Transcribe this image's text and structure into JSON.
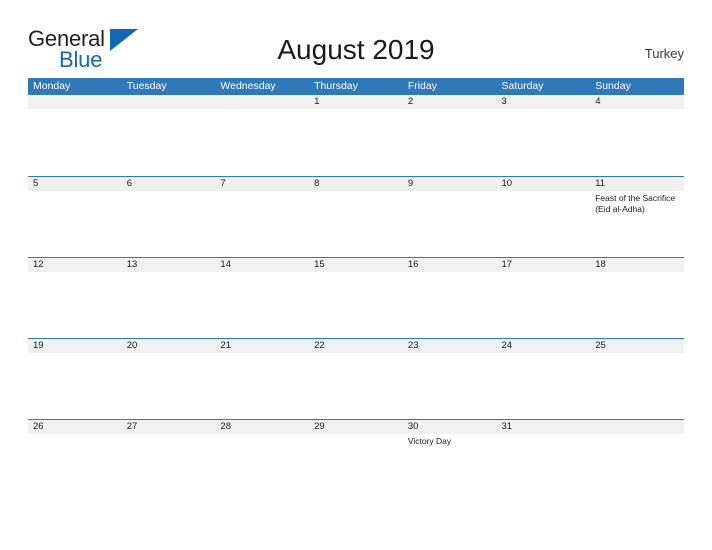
{
  "brand": {
    "name_part1": "General",
    "name_part2": "Blue",
    "triangle_color": "#1268b3",
    "text_color": "#231f20"
  },
  "header": {
    "title": "August 2019",
    "region": "Turkey"
  },
  "theme": {
    "header_blue": "#3178b8",
    "date_band_gray": "#f0f0f0",
    "page_background": "#ffffff",
    "text_color": "#1a1a1a"
  },
  "calendar": {
    "month": "August",
    "year": "2019",
    "weekday_headers": [
      "Monday",
      "Tuesday",
      "Wednesday",
      "Thursday",
      "Friday",
      "Saturday",
      "Sunday"
    ],
    "weeks": [
      {
        "days": [
          {
            "number": "",
            "events": []
          },
          {
            "number": "",
            "events": []
          },
          {
            "number": "",
            "events": []
          },
          {
            "number": "1",
            "events": []
          },
          {
            "number": "2",
            "events": []
          },
          {
            "number": "3",
            "events": []
          },
          {
            "number": "4",
            "events": []
          }
        ]
      },
      {
        "days": [
          {
            "number": "5",
            "events": []
          },
          {
            "number": "6",
            "events": []
          },
          {
            "number": "7",
            "events": []
          },
          {
            "number": "8",
            "events": []
          },
          {
            "number": "9",
            "events": []
          },
          {
            "number": "10",
            "events": []
          },
          {
            "number": "11",
            "events": [
              "Feast of the Sacrifice (Eid al-Adha)"
            ]
          }
        ]
      },
      {
        "days": [
          {
            "number": "12",
            "events": []
          },
          {
            "number": "13",
            "events": []
          },
          {
            "number": "14",
            "events": []
          },
          {
            "number": "15",
            "events": []
          },
          {
            "number": "16",
            "events": []
          },
          {
            "number": "17",
            "events": []
          },
          {
            "number": "18",
            "events": []
          }
        ]
      },
      {
        "days": [
          {
            "number": "19",
            "events": []
          },
          {
            "number": "20",
            "events": []
          },
          {
            "number": "21",
            "events": []
          },
          {
            "number": "22",
            "events": []
          },
          {
            "number": "23",
            "events": []
          },
          {
            "number": "24",
            "events": []
          },
          {
            "number": "25",
            "events": []
          }
        ]
      },
      {
        "days": [
          {
            "number": "26",
            "events": []
          },
          {
            "number": "27",
            "events": []
          },
          {
            "number": "28",
            "events": []
          },
          {
            "number": "29",
            "events": []
          },
          {
            "number": "30",
            "events": [
              "Victory Day"
            ]
          },
          {
            "number": "31",
            "events": []
          },
          {
            "number": "",
            "events": []
          }
        ]
      }
    ]
  }
}
